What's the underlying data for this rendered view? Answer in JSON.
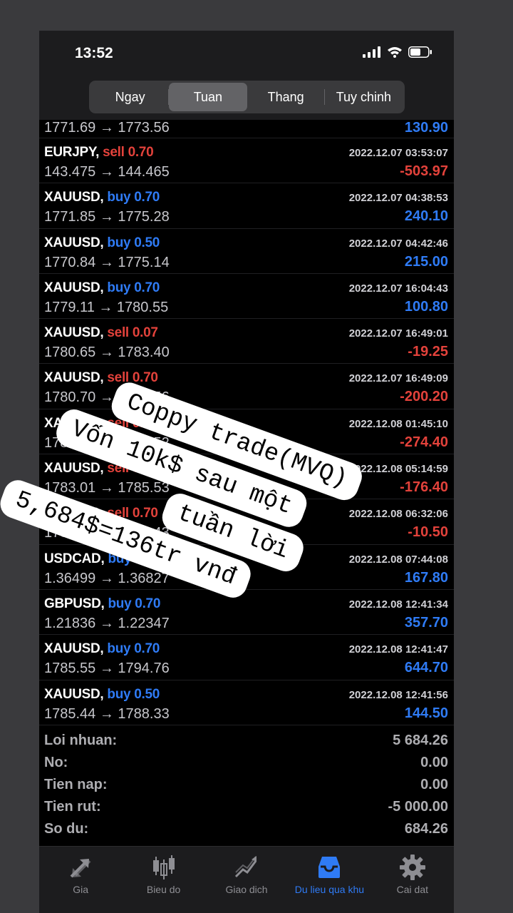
{
  "status_bar": {
    "time": "13:52"
  },
  "segments": [
    {
      "label": "Ngay",
      "active": false
    },
    {
      "label": "Tuan",
      "active": true
    },
    {
      "label": "Thang",
      "active": false
    },
    {
      "label": "Tuy chinh",
      "active": false
    }
  ],
  "partial_row": {
    "prices": "1771.69 → 1773.56",
    "profit": "130.90"
  },
  "trades": [
    {
      "symbol": "EURJPY,",
      "side": "sell 0.70",
      "type": "sell",
      "datetime": "2022.12.07 03:53:07",
      "prices": "143.475 → 144.465",
      "profit": "-503.97"
    },
    {
      "symbol": "XAUUSD,",
      "side": "buy 0.70",
      "type": "buy",
      "datetime": "2022.12.07 04:38:53",
      "prices": "1771.85 → 1775.28",
      "profit": "240.10"
    },
    {
      "symbol": "XAUUSD,",
      "side": "buy 0.50",
      "type": "buy",
      "datetime": "2022.12.07 04:42:46",
      "prices": "1770.84 → 1775.14",
      "profit": "215.00"
    },
    {
      "symbol": "XAUUSD,",
      "side": "buy 0.70",
      "type": "buy",
      "datetime": "2022.12.07 16:04:43",
      "prices": "1779.11 → 1780.55",
      "profit": "100.80"
    },
    {
      "symbol": "XAUUSD,",
      "side": "sell 0.07",
      "type": "sell",
      "datetime": "2022.12.07 16:49:01",
      "prices": "1780.65 → 1783.40",
      "profit": "-19.25"
    },
    {
      "symbol": "XAUUSD,",
      "side": "sell 0.70",
      "type": "sell",
      "datetime": "2022.12.07 16:49:09",
      "prices": "1780.70 → 1783.56",
      "profit": "-200.20"
    },
    {
      "symbol": "XAUUSD,",
      "side": "sell 0.70",
      "type": "sell",
      "datetime": "2022.12.08 01:45:10",
      "prices": "1781.60 → 1785.52",
      "profit": "-274.40"
    },
    {
      "symbol": "XAUUSD,",
      "side": "sell 0.70",
      "type": "sell",
      "datetime": "2022.12.08 05:14:59",
      "prices": "1783.01 → 1785.53",
      "profit": "-176.40"
    },
    {
      "symbol": "XAUUSD,",
      "side": "sell 0.70",
      "type": "sell",
      "datetime": "2022.12.08 06:32:06",
      "prices": "1785.28 → 1785.43",
      "profit": "-10.50"
    },
    {
      "symbol": "USDCAD,",
      "side": "buy 0.70",
      "type": "buy",
      "datetime": "2022.12.08 07:44:08",
      "prices": "1.36499 → 1.36827",
      "profit": "167.80"
    },
    {
      "symbol": "GBPUSD,",
      "side": "buy 0.70",
      "type": "buy",
      "datetime": "2022.12.08 12:41:34",
      "prices": "1.21836 → 1.22347",
      "profit": "357.70"
    },
    {
      "symbol": "XAUUSD,",
      "side": "buy 0.70",
      "type": "buy",
      "datetime": "2022.12.08 12:41:47",
      "prices": "1785.55 → 1794.76",
      "profit": "644.70"
    },
    {
      "symbol": "XAUUSD,",
      "side": "buy 0.50",
      "type": "buy",
      "datetime": "2022.12.08 12:41:56",
      "prices": "1785.44 → 1788.33",
      "profit": "144.50"
    }
  ],
  "summary": [
    {
      "label": "Loi nhuan:",
      "value": "5 684.26"
    },
    {
      "label": "No:",
      "value": "0.00"
    },
    {
      "label": "Tien nap:",
      "value": "0.00"
    },
    {
      "label": "Tien rut:",
      "value": "-5 000.00"
    },
    {
      "label": "So du:",
      "value": "684.26"
    }
  ],
  "tabs": [
    {
      "label": "Gia",
      "icon": "price-arrows-icon",
      "active": false
    },
    {
      "label": "Bieu do",
      "icon": "candlestick-icon",
      "active": false
    },
    {
      "label": "Giao dich",
      "icon": "trade-chart-icon",
      "active": false
    },
    {
      "label": "Du lieu qua khu",
      "icon": "history-inbox-icon",
      "active": true
    },
    {
      "label": "Cai dat",
      "icon": "gear-icon",
      "active": false
    }
  ],
  "overlay_text": {
    "line1": "Coppy trade(MVQ)",
    "line2": "Vốn 10k$ sau một",
    "line3": "tuần lời",
    "line4": "5,684$=136tr vnđ"
  },
  "colors": {
    "buy": "#2f7bf5",
    "sell": "#e3423b",
    "active_tab": "#2f7bf5"
  }
}
